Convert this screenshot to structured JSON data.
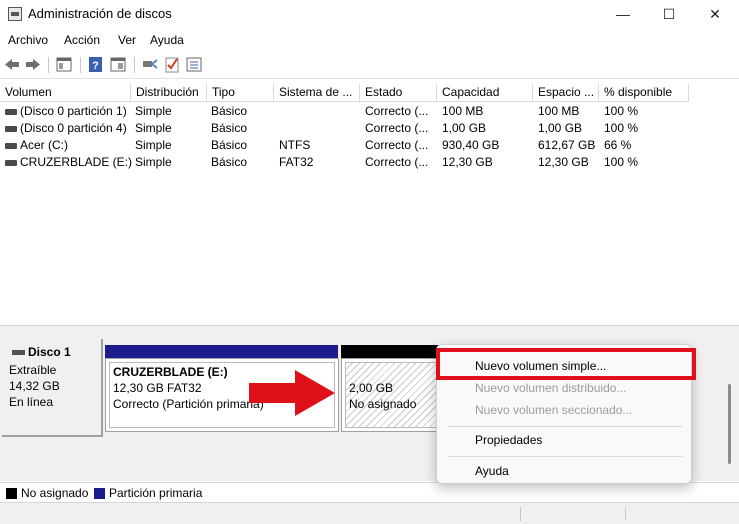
{
  "window": {
    "title": "Administración de discos",
    "minimize": "—",
    "maximize": "☐",
    "close": "✕"
  },
  "menu": [
    "Archivo",
    "Acción",
    "Ver",
    "Ayuda"
  ],
  "toolbar": {
    "icons": [
      "back-icon",
      "forward-icon",
      "console-tree-icon",
      "help-icon",
      "properties-icon",
      "connect-icon",
      "check-icon",
      "list-icon"
    ]
  },
  "volumes": {
    "columns": [
      "Volumen",
      "Distribución",
      "Tipo",
      "Sistema de ...",
      "Estado",
      "Capacidad",
      "Espacio ...",
      "% disponible"
    ],
    "rows": [
      {
        "volume": "(Disco 0 partición 1)",
        "layout": "Simple",
        "type": "Básico",
        "fs": "",
        "status": "Correcto (...",
        "capacity": "100 MB",
        "free": "100 MB",
        "pct": "100 %"
      },
      {
        "volume": "(Disco 0 partición 4)",
        "layout": "Simple",
        "type": "Básico",
        "fs": "",
        "status": "Correcto (...",
        "capacity": "1,00 GB",
        "free": "1,00 GB",
        "pct": "100 %"
      },
      {
        "volume": "Acer (C:)",
        "layout": "Simple",
        "type": "Básico",
        "fs": "NTFS",
        "status": "Correcto (...",
        "capacity": "930,40 GB",
        "free": "612,67 GB",
        "pct": "66 %"
      },
      {
        "volume": "CRUZERBLADE (E:)",
        "layout": "Simple",
        "type": "Básico",
        "fs": "FAT32",
        "status": "Correcto (...",
        "capacity": "12,30 GB",
        "free": "12,30 GB",
        "pct": "100 %"
      }
    ]
  },
  "disk": {
    "name": "Disco 1",
    "kind": "Extraíble",
    "size": "14,32 GB",
    "state": "En línea",
    "partitions": [
      {
        "title": "CRUZERBLADE  (E:)",
        "line1": "12,30 GB FAT32",
        "line2": "Correcto (Partición primaria)"
      },
      {
        "title": "",
        "line1": "2,00 GB",
        "line2": "No asignado"
      }
    ]
  },
  "legend": [
    {
      "label": "No asignado",
      "color": "#000000"
    },
    {
      "label": "Partición primaria",
      "color": "#1c1c8c"
    }
  ],
  "context_menu": {
    "items": [
      {
        "label": "Nuevo volumen simple...",
        "enabled": true
      },
      {
        "label": "Nuevo volumen distribuido...",
        "enabled": false
      },
      {
        "label": "Nuevo volumen seccionado...",
        "enabled": false
      },
      {
        "label": "Propiedades",
        "enabled": true
      },
      {
        "label": "Ayuda",
        "enabled": true
      }
    ]
  },
  "colors": {
    "primary_partition": "#1c1c8c",
    "unallocated": "#000000",
    "highlight": "#e0101a",
    "arrow": "#e0101a"
  }
}
